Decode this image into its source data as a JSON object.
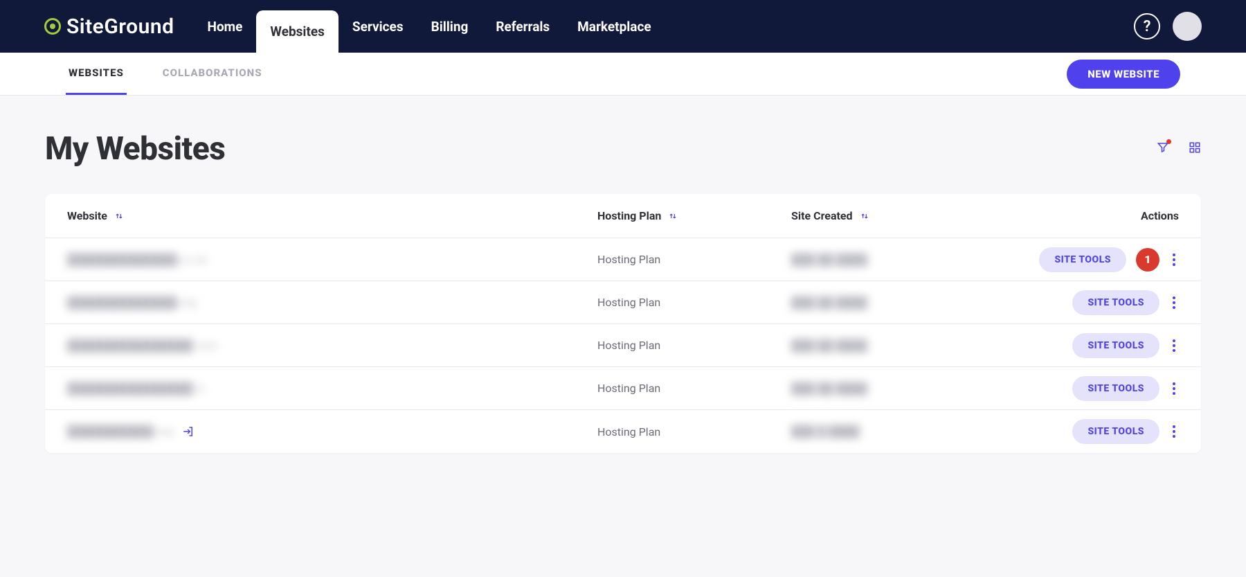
{
  "brand": "SiteGround",
  "nav": {
    "items": [
      "Home",
      "Websites",
      "Services",
      "Billing",
      "Referrals",
      "Marketplace"
    ],
    "activeIndex": 1
  },
  "help_glyph": "?",
  "subnav": {
    "tabs": [
      "WEBSITES",
      "COLLABORATIONS"
    ],
    "activeIndex": 0,
    "cta": "NEW WEBSITE"
  },
  "page_title": "My Websites",
  "table": {
    "columns": {
      "website": "Website",
      "plan": "Hosting Plan",
      "created": "Site Created",
      "actions": "Actions"
    },
    "site_tools_label": "SITE TOOLS",
    "rows": [
      {
        "website": "██████████████.co.uk",
        "plan": "Hosting Plan",
        "created": "███ ██ ████",
        "badge": "1",
        "has_login": false
      },
      {
        "website": "██████████████.org",
        "plan": "Hosting Plan",
        "created": "███ ██ ████",
        "badge": null,
        "has_login": false
      },
      {
        "website": "████████████████.com",
        "plan": "Hosting Plan",
        "created": "███ ██ ████",
        "badge": null,
        "has_login": false
      },
      {
        "website": "████████████████.io",
        "plan": "Hosting Plan",
        "created": "███ ██ ████",
        "badge": null,
        "has_login": false
      },
      {
        "website": "███████████.org",
        "plan": "Hosting Plan",
        "created": "███ █ ████",
        "badge": null,
        "has_login": true
      }
    ]
  }
}
